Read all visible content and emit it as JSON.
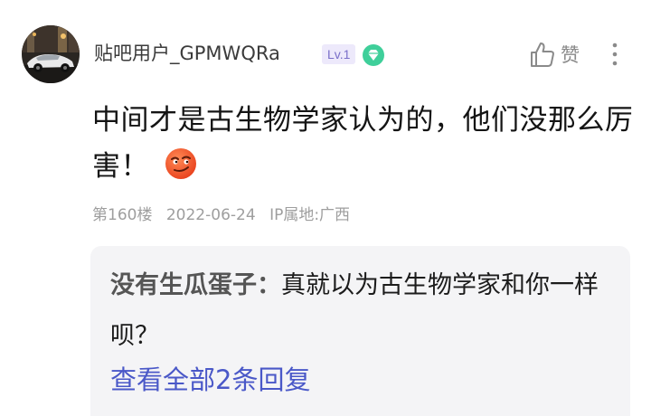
{
  "post": {
    "username": "贴吧用户_GPMWQRa",
    "level_badge": "Lv.1",
    "like_label": "赞",
    "content": "中间才是古生物学家认为的，他们没那么厉害！",
    "emoji_icon": "smirk-face-emoji",
    "floor": "第160楼",
    "date": "2022-06-24",
    "ip_location": "IP属地:广西"
  },
  "reply": {
    "author": "没有生瓜蛋子：",
    "text": "真就以为古生物学家和你一样呗？",
    "view_all_label": "查看全部2条回复"
  },
  "icons": {
    "like": "thumbs-up-icon",
    "more": "more-vertical-icon",
    "gem": "gem-icon",
    "avatar": "avatar"
  },
  "colors": {
    "level_badge_text": "#7a6fc9",
    "level_badge_bg": "#ede9fb",
    "gem": "#3fcf9a",
    "link": "#4a58c8",
    "meta": "#9e9e9e",
    "reply_bg": "#f4f4f6"
  }
}
